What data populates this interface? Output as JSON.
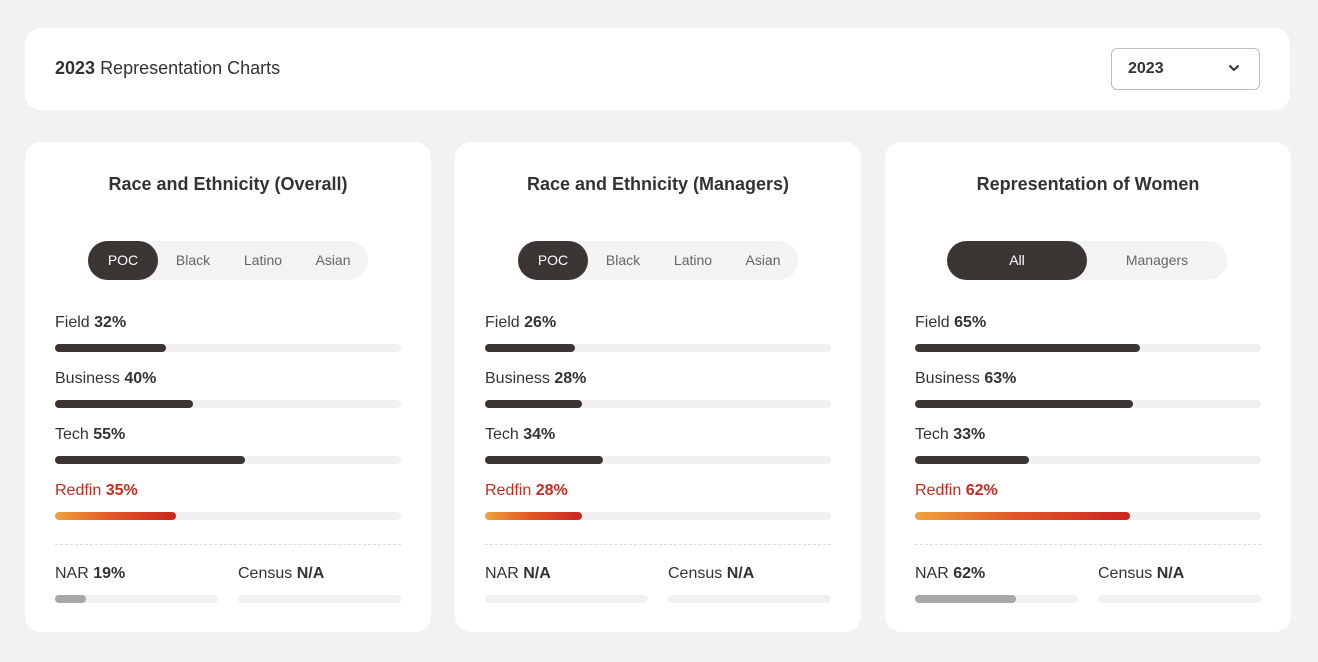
{
  "header": {
    "title_year": "2023",
    "title_text": "Representation Charts",
    "year_select": {
      "value": "2023",
      "icon": "chevron-down-icon"
    }
  },
  "colors": {
    "dark_bar": "#3b3533",
    "accent_red": "#c8291d",
    "benchmark_bar": "#a8a8a8"
  },
  "cards": [
    {
      "title": "Race and Ethnicity (Overall)",
      "tabs": [
        "POC",
        "Black",
        "Latino",
        "Asian"
      ],
      "active_tab": 0,
      "metrics": [
        {
          "label": "Field",
          "value": "32%",
          "fraction": 0.32
        },
        {
          "label": "Business",
          "value": "40%",
          "fraction": 0.4
        },
        {
          "label": "Tech",
          "value": "55%",
          "fraction": 0.55
        },
        {
          "label": "Redfin",
          "value": "35%",
          "fraction": 0.35,
          "highlight": true
        }
      ],
      "benchmarks": [
        {
          "label": "NAR",
          "value": "19%",
          "fraction": 0.19
        },
        {
          "label": "Census",
          "value": "N/A",
          "fraction": 0
        }
      ]
    },
    {
      "title": "Race and Ethnicity (Managers)",
      "tabs": [
        "POC",
        "Black",
        "Latino",
        "Asian"
      ],
      "active_tab": 0,
      "metrics": [
        {
          "label": "Field",
          "value": "26%",
          "fraction": 0.26
        },
        {
          "label": "Business",
          "value": "28%",
          "fraction": 0.28
        },
        {
          "label": "Tech",
          "value": "34%",
          "fraction": 0.34
        },
        {
          "label": "Redfin",
          "value": "28%",
          "fraction": 0.28,
          "highlight": true
        }
      ],
      "benchmarks": [
        {
          "label": "NAR",
          "value": "N/A",
          "fraction": 0
        },
        {
          "label": "Census",
          "value": "N/A",
          "fraction": 0
        }
      ]
    },
    {
      "title": "Representation of Women",
      "tabs": [
        "All",
        "Managers"
      ],
      "active_tab": 0,
      "metrics": [
        {
          "label": "Field",
          "value": "65%",
          "fraction": 0.65
        },
        {
          "label": "Business",
          "value": "63%",
          "fraction": 0.63
        },
        {
          "label": "Tech",
          "value": "33%",
          "fraction": 0.33
        },
        {
          "label": "Redfin",
          "value": "62%",
          "fraction": 0.62,
          "highlight": true
        }
      ],
      "benchmarks": [
        {
          "label": "NAR",
          "value": "62%",
          "fraction": 0.62
        },
        {
          "label": "Census",
          "value": "N/A",
          "fraction": 0
        }
      ]
    }
  ]
}
